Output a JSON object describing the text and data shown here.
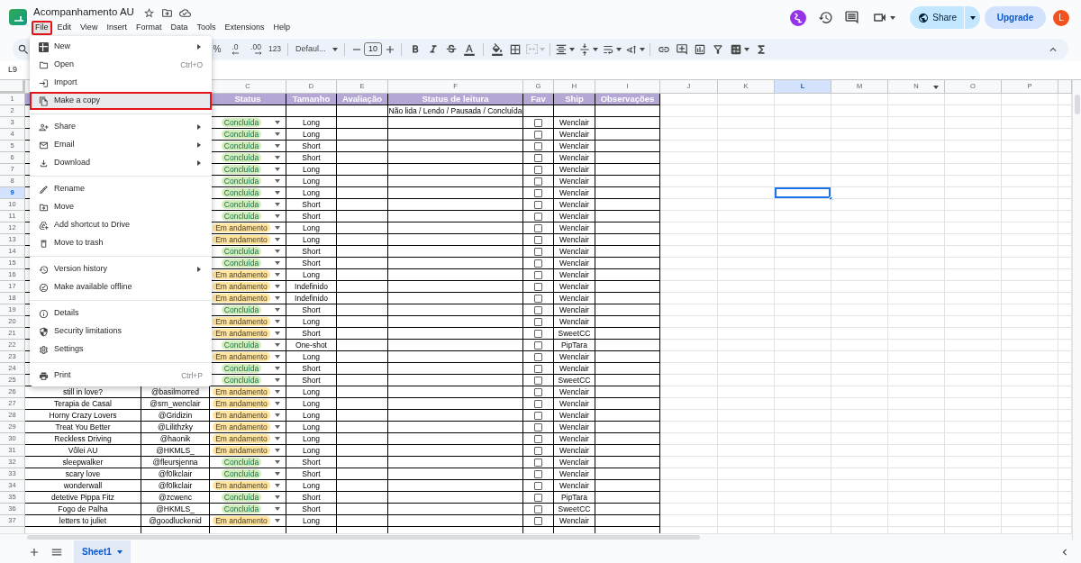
{
  "window": {
    "title": "Acompanhamento AU"
  },
  "menu_bar": [
    {
      "label": "File",
      "selected": true,
      "outlined": true
    },
    {
      "label": "Edit",
      "selected": false,
      "outlined": false
    },
    {
      "label": "View",
      "selected": false,
      "outlined": false
    },
    {
      "label": "Insert",
      "selected": false,
      "outlined": false
    },
    {
      "label": "Format",
      "selected": false,
      "outlined": false
    },
    {
      "label": "Data",
      "selected": false,
      "outlined": false
    },
    {
      "label": "Tools",
      "selected": false,
      "outlined": false
    },
    {
      "label": "Extensions",
      "selected": false,
      "outlined": false
    },
    {
      "label": "Help",
      "selected": false,
      "outlined": false
    }
  ],
  "account": {
    "share_label": "Share",
    "upgrade_label": "Upgrade",
    "initial": "L"
  },
  "toolbar": {
    "number_formats": [
      "%",
      ".0",
      ".00",
      "123"
    ],
    "font": "Defaul...",
    "font_size": "10",
    "merge": {
      "disabled": true
    }
  },
  "name_box": "L9",
  "columns": [
    {
      "letter": "C",
      "selected": false,
      "filter": false
    },
    {
      "letter": "D",
      "selected": false,
      "filter": false
    },
    {
      "letter": "E",
      "selected": false,
      "filter": false
    },
    {
      "letter": "F",
      "selected": false,
      "filter": false
    },
    {
      "letter": "G",
      "selected": false,
      "filter": false
    },
    {
      "letter": "H",
      "selected": false,
      "filter": false
    },
    {
      "letter": "I",
      "selected": false,
      "filter": false
    },
    {
      "letter": "J",
      "selected": false,
      "filter": false
    },
    {
      "letter": "K",
      "selected": false,
      "filter": false
    },
    {
      "letter": "L",
      "selected": true,
      "filter": false
    },
    {
      "letter": "M",
      "selected": false,
      "filter": false
    },
    {
      "letter": "N",
      "selected": false,
      "filter": true
    },
    {
      "letter": "O",
      "selected": false,
      "filter": false
    },
    {
      "letter": "P",
      "selected": false,
      "filter": false
    }
  ],
  "sheet": {
    "header_row": {
      "number": "1",
      "selected": false,
      "labels": [
        "Status",
        "Tamanho",
        "Avaliação",
        "Status de leitura",
        "Fav",
        "Ship",
        "Observações"
      ]
    },
    "hint_row": {
      "number": "2",
      "selected": false,
      "reading_status_hint": "Não lida / Lendo / Pausada / Concluída"
    },
    "rows": [
      {
        "number": "3",
        "selected": false,
        "status": {
          "label": "Concluída",
          "color": "#d4edbc"
        },
        "size": "Long",
        "fav": false,
        "ship": "Wenclair"
      },
      {
        "number": "4",
        "selected": false,
        "status": {
          "label": "Concluída",
          "color": "#d4edbc"
        },
        "size": "Long",
        "fav": false,
        "ship": "Wenclair"
      },
      {
        "number": "5",
        "selected": false,
        "status": {
          "label": "Concluída",
          "color": "#d4edbc"
        },
        "size": "Short",
        "fav": false,
        "ship": "Wenclair"
      },
      {
        "number": "6",
        "selected": false,
        "status": {
          "label": "Concluída",
          "color": "#d4edbc"
        },
        "size": "Short",
        "fav": false,
        "ship": "Wenclair"
      },
      {
        "number": "7",
        "selected": false,
        "status": {
          "label": "Concluída",
          "color": "#d4edbc"
        },
        "size": "Long",
        "fav": false,
        "ship": "Wenclair"
      },
      {
        "number": "8",
        "selected": false,
        "status": {
          "label": "Concluída",
          "color": "#d4edbc"
        },
        "size": "Long",
        "fav": false,
        "ship": "Wenclair"
      },
      {
        "number": "9",
        "selected": true,
        "status": {
          "label": "Concluída",
          "color": "#d4edbc"
        },
        "size": "Long",
        "fav": false,
        "ship": "Wenclair"
      },
      {
        "number": "10",
        "selected": false,
        "status": {
          "label": "Concluída",
          "color": "#d4edbc"
        },
        "size": "Short",
        "fav": false,
        "ship": "Wenclair"
      },
      {
        "number": "11",
        "selected": false,
        "status": {
          "label": "Concluída",
          "color": "#d4edbc"
        },
        "size": "Short",
        "fav": false,
        "ship": "Wenclair"
      },
      {
        "number": "12",
        "selected": false,
        "status": {
          "label": "Em andamento",
          "color": "#ffe5a0"
        },
        "size": "Long",
        "fav": false,
        "ship": "Wenclair"
      },
      {
        "number": "13",
        "selected": false,
        "status": {
          "label": "Em andamento",
          "color": "#ffe5a0"
        },
        "size": "Long",
        "fav": false,
        "ship": "Wenclair"
      },
      {
        "number": "14",
        "selected": false,
        "status": {
          "label": "Concluída",
          "color": "#d4edbc"
        },
        "size": "Short",
        "fav": false,
        "ship": "Wenclair"
      },
      {
        "number": "15",
        "selected": false,
        "status": {
          "label": "Concluída",
          "color": "#d4edbc"
        },
        "size": "Short",
        "fav": false,
        "ship": "Wenclair"
      },
      {
        "number": "16",
        "selected": false,
        "status": {
          "label": "Em andamento",
          "color": "#ffe5a0"
        },
        "size": "Long",
        "fav": false,
        "ship": "Wenclair"
      },
      {
        "number": "17",
        "selected": false,
        "status": {
          "label": "Em andamento",
          "color": "#ffe5a0"
        },
        "size": "Indefinido",
        "fav": false,
        "ship": "Wenclair"
      },
      {
        "number": "18",
        "selected": false,
        "status": {
          "label": "Em andamento",
          "color": "#ffe5a0"
        },
        "size": "Indefinido",
        "fav": false,
        "ship": "Wenclair"
      },
      {
        "number": "19",
        "selected": false,
        "status": {
          "label": "Concluída",
          "color": "#d4edbc"
        },
        "size": "Short",
        "fav": false,
        "ship": "Wenclair"
      },
      {
        "number": "20",
        "selected": false,
        "status": {
          "label": "Em andamento",
          "color": "#ffe5a0"
        },
        "size": "Long",
        "fav": false,
        "ship": "Wenclair"
      },
      {
        "number": "21",
        "selected": false,
        "status": {
          "label": "Em andamento",
          "color": "#ffe5a0"
        },
        "size": "Short",
        "fav": false,
        "ship": "SweetCC"
      },
      {
        "number": "22",
        "selected": false,
        "status": {
          "label": "Concluída",
          "color": "#d4edbc"
        },
        "size": "One-shot",
        "fav": false,
        "ship": "PipTara"
      },
      {
        "number": "23",
        "selected": false,
        "status": {
          "label": "Em andamento",
          "color": "#ffe5a0"
        },
        "size": "Long",
        "fav": false,
        "ship": "Wenclair"
      },
      {
        "number": "24",
        "selected": false,
        "status": {
          "label": "Concluída",
          "color": "#d4edbc"
        },
        "size": "Short",
        "fav": false,
        "ship": "Wenclair"
      },
      {
        "number": "25",
        "selected": false,
        "status": {
          "label": "Concluída",
          "color": "#d4edbc"
        },
        "size": "Short",
        "fav": false,
        "ship": "SweetCC"
      },
      {
        "number": "26",
        "selected": false,
        "title": "still in love?",
        "author": "@basilmorred",
        "status": {
          "label": "Em andamento",
          "color": "#ffe5a0"
        },
        "size": "Long",
        "fav": false,
        "ship": "Wenclair"
      },
      {
        "number": "27",
        "selected": false,
        "title": "Terapia de Casal",
        "author": "@srn_wenclair",
        "status": {
          "label": "Em andamento",
          "color": "#ffe5a0"
        },
        "size": "Long",
        "fav": false,
        "ship": "Wenclair"
      },
      {
        "number": "28",
        "selected": false,
        "title": "Horny Crazy Lovers",
        "author": "@Gridizin",
        "status": {
          "label": "Em andamento",
          "color": "#ffe5a0"
        },
        "size": "Long",
        "fav": false,
        "ship": "Wenclair"
      },
      {
        "number": "29",
        "selected": false,
        "title": "Treat You Better",
        "author": "@Lilithzky",
        "status": {
          "label": "Em andamento",
          "color": "#ffe5a0"
        },
        "size": "Long",
        "fav": false,
        "ship": "Wenclair"
      },
      {
        "number": "30",
        "selected": false,
        "title": "Reckless Driving",
        "author": "@haonik",
        "status": {
          "label": "Em andamento",
          "color": "#ffe5a0"
        },
        "size": "Long",
        "fav": false,
        "ship": "Wenclair"
      },
      {
        "number": "31",
        "selected": false,
        "title": "Vôlei AU",
        "author": "@HKMLS_",
        "status": {
          "label": "Em andamento",
          "color": "#ffe5a0"
        },
        "size": "Long",
        "fav": false,
        "ship": "Wenclair"
      },
      {
        "number": "32",
        "selected": false,
        "title": "sleepwalker",
        "author": "@fleursjenna",
        "status": {
          "label": "Concluída",
          "color": "#d4edbc"
        },
        "size": "Short",
        "fav": false,
        "ship": "Wenclair"
      },
      {
        "number": "33",
        "selected": false,
        "title": "scary love",
        "author": "@f0lkclair",
        "status": {
          "label": "Concluída",
          "color": "#d4edbc"
        },
        "size": "Short",
        "fav": false,
        "ship": "Wenclair"
      },
      {
        "number": "34",
        "selected": false,
        "title": "wonderwall",
        "author": "@f0lkclair",
        "status": {
          "label": "Em andamento",
          "color": "#ffe5a0"
        },
        "size": "Long",
        "fav": false,
        "ship": "Wenclair"
      },
      {
        "number": "35",
        "selected": false,
        "title": "detetive Pippa Fitz",
        "author": "@zcwenc",
        "status": {
          "label": "Concluída",
          "color": "#d4edbc"
        },
        "size": "Short",
        "fav": false,
        "ship": "PipTara"
      },
      {
        "number": "36",
        "selected": false,
        "title": "Fogo de Palha",
        "author": "@HKMLS_",
        "status": {
          "label": "Concluída",
          "color": "#d4edbc"
        },
        "size": "Short",
        "fav": false,
        "ship": "SweetCC"
      },
      {
        "number": "37",
        "selected": false,
        "title": "letters to juliet",
        "author": "@goodluckenid",
        "status": {
          "label": "Em andamento",
          "color": "#ffe5a0"
        },
        "size": "Long",
        "fav": false,
        "ship": "Wenclair"
      }
    ]
  },
  "sheet_tabs": [
    {
      "label": "Sheet1",
      "selected": true
    }
  ],
  "file_menu": {
    "sections": [
      [
        {
          "label": "New",
          "submenu": true,
          "highlighted": false,
          "outlined": false
        },
        {
          "label": "Open",
          "shortcut": "Ctrl+O",
          "submenu": false,
          "highlighted": false,
          "outlined": false
        },
        {
          "label": "Import",
          "submenu": false,
          "highlighted": false,
          "outlined": false
        },
        {
          "label": "Make a copy",
          "submenu": false,
          "highlighted": true,
          "outlined": true
        }
      ],
      [
        {
          "label": "Share",
          "submenu": true,
          "highlighted": false,
          "outlined": false
        },
        {
          "label": "Email",
          "submenu": true,
          "highlighted": false,
          "outlined": false
        },
        {
          "label": "Download",
          "submenu": true,
          "highlighted": false,
          "outlined": false
        }
      ],
      [
        {
          "label": "Rename",
          "submenu": false,
          "highlighted": false,
          "outlined": false
        },
        {
          "label": "Move",
          "submenu": false,
          "highlighted": false,
          "outlined": false
        },
        {
          "label": "Add shortcut to Drive",
          "submenu": false,
          "highlighted": false,
          "outlined": false
        },
        {
          "label": "Move to trash",
          "submenu": false,
          "highlighted": false,
          "outlined": false
        }
      ],
      [
        {
          "label": "Version history",
          "submenu": true,
          "highlighted": false,
          "outlined": false
        },
        {
          "label": "Make available offline",
          "submenu": false,
          "highlighted": false,
          "outlined": false
        }
      ],
      [
        {
          "label": "Details",
          "submenu": false,
          "highlighted": false,
          "outlined": false
        },
        {
          "label": "Security limitations",
          "submenu": false,
          "highlighted": false,
          "outlined": false
        },
        {
          "label": "Settings",
          "submenu": false,
          "highlighted": false,
          "outlined": false
        }
      ],
      [
        {
          "label": "Print",
          "shortcut": "Ctrl+P",
          "submenu": false,
          "highlighted": false,
          "outlined": false
        }
      ]
    ]
  }
}
